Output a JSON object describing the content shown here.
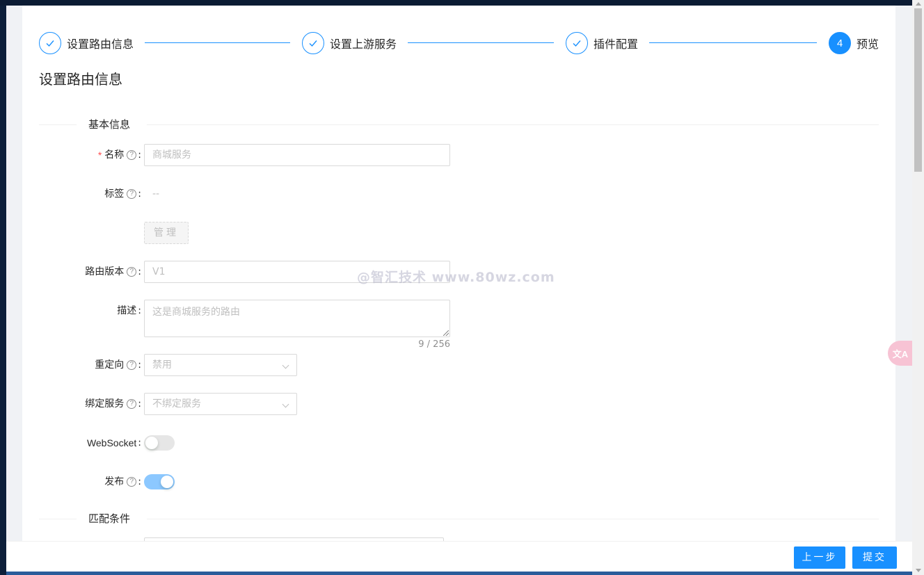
{
  "steps": [
    {
      "title": "设置路由信息",
      "status": "done"
    },
    {
      "title": "设置上游服务",
      "status": "done"
    },
    {
      "title": "插件配置",
      "status": "done"
    },
    {
      "title": "预览",
      "status": "active",
      "number": "4"
    }
  ],
  "page_title": "设置路由信息",
  "sections": {
    "basic": "基本信息",
    "match": "匹配条件"
  },
  "form": {
    "name": {
      "label": "名称",
      "required_mark": "*",
      "placeholder": "商城服务"
    },
    "labels": {
      "label": "标签",
      "value": "--",
      "manage_button": "管理"
    },
    "version": {
      "label": "路由版本",
      "placeholder": "V1"
    },
    "desc": {
      "label": "描述",
      "placeholder": "这是商城服务的路由",
      "count": "9 / 256"
    },
    "redirect": {
      "label": "重定向",
      "value": "禁用"
    },
    "bind_service": {
      "label": "绑定服务",
      "value": "不绑定服务"
    },
    "websocket": {
      "label": "WebSocket",
      "enabled": false
    },
    "publish": {
      "label": "发布",
      "enabled": true
    }
  },
  "colon": ":",
  "help_glyph": "?",
  "watermark": "@智汇技术 www.80wz.com",
  "footer": {
    "prev": "上一步",
    "submit": "提交"
  },
  "translate_icon": "文A",
  "colors": {
    "primary": "#1890ff",
    "required": "#ff4d4f"
  }
}
